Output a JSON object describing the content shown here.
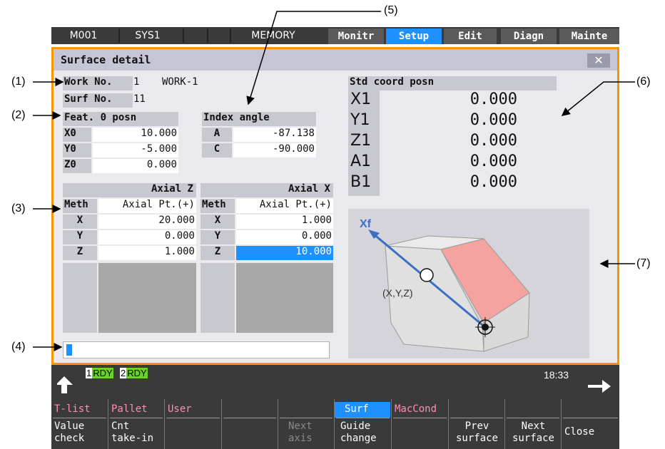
{
  "callouts": [
    "(1)",
    "(2)",
    "(3)",
    "(4)",
    "(5)",
    "(6)",
    "(7)"
  ],
  "topbar": {
    "machine": "M001",
    "system": "SYS1",
    "mode": "MEMORY",
    "tabs": [
      "Monitr",
      "Setup",
      "Edit",
      "Diagn",
      "Mainte"
    ],
    "active_tab": "Setup"
  },
  "dialog": {
    "title": "Surface detail",
    "work_no_label": "Work No.",
    "work_no": "1",
    "work_name": "WORK-1",
    "surf_no_label": "Surf No.",
    "surf_no": "11",
    "feat_title": "Feat. 0 posn",
    "feat": [
      {
        "axis": "X0",
        "value": "10.000"
      },
      {
        "axis": "Y0",
        "value": "-5.000"
      },
      {
        "axis": "Z0",
        "value": "0.000"
      }
    ],
    "index_title": "Index angle",
    "index": [
      {
        "axis": "A",
        "value": "-87.138"
      },
      {
        "axis": "C",
        "value": "-90.000"
      }
    ],
    "std_title": "Std coord posn",
    "std": [
      {
        "axis": "X1",
        "value": "0.000"
      },
      {
        "axis": "Y1",
        "value": "0.000"
      },
      {
        "axis": "Z1",
        "value": "0.000"
      },
      {
        "axis": "A1",
        "value": "0.000"
      },
      {
        "axis": "B1",
        "value": "0.000"
      }
    ],
    "axial_z": {
      "title": "Axial Z",
      "meth_label": "Meth",
      "method": "Axial Pt.(+)",
      "rows": [
        {
          "axis": "X",
          "value": "20.000"
        },
        {
          "axis": "Y",
          "value": "0.000"
        },
        {
          "axis": "Z",
          "value": "1.000"
        }
      ]
    },
    "axial_x": {
      "title": "Axial X",
      "meth_label": "Meth",
      "method": "Axial Pt.(+)",
      "rows": [
        {
          "axis": "X",
          "value": "1.000"
        },
        {
          "axis": "Y",
          "value": "0.000"
        },
        {
          "axis": "Z",
          "value": "10.000"
        }
      ]
    },
    "guide": {
      "axis_label": "Xf",
      "point_label": "(X,Y,Z)"
    }
  },
  "status": {
    "rdy1_num": "1",
    "rdy1": "RDY",
    "rdy2_num": "2",
    "rdy2": "RDY",
    "clock": "18:33"
  },
  "softkeys": [
    {
      "top": "T-list",
      "bottom": [
        "Value",
        "check"
      ]
    },
    {
      "top": "Pallet",
      "bottom": [
        "Cnt",
        "take-in"
      ]
    },
    {
      "top": "User",
      "bottom": [
        "",
        ""
      ]
    },
    {
      "top": "",
      "bottom": [
        "",
        ""
      ]
    },
    {
      "top": "",
      "bottom": [
        "Next",
        "axis"
      ]
    },
    {
      "top": "Surf",
      "bottom": [
        "Guide",
        "change"
      ]
    },
    {
      "top": "MacCond",
      "bottom": [
        "",
        ""
      ]
    },
    {
      "top": "",
      "bottom": [
        "Prev",
        "surface"
      ]
    },
    {
      "top": "",
      "bottom": [
        "Next",
        "surface"
      ]
    },
    {
      "top": "",
      "bottom": [
        "Close",
        ""
      ]
    }
  ],
  "colors": {
    "accent": "#1e90ff",
    "dialog_border": "#f39800",
    "rdy": "#6ad12a",
    "softkey_top": "#ff8fb0",
    "guide_face": "#f4a3a0"
  }
}
